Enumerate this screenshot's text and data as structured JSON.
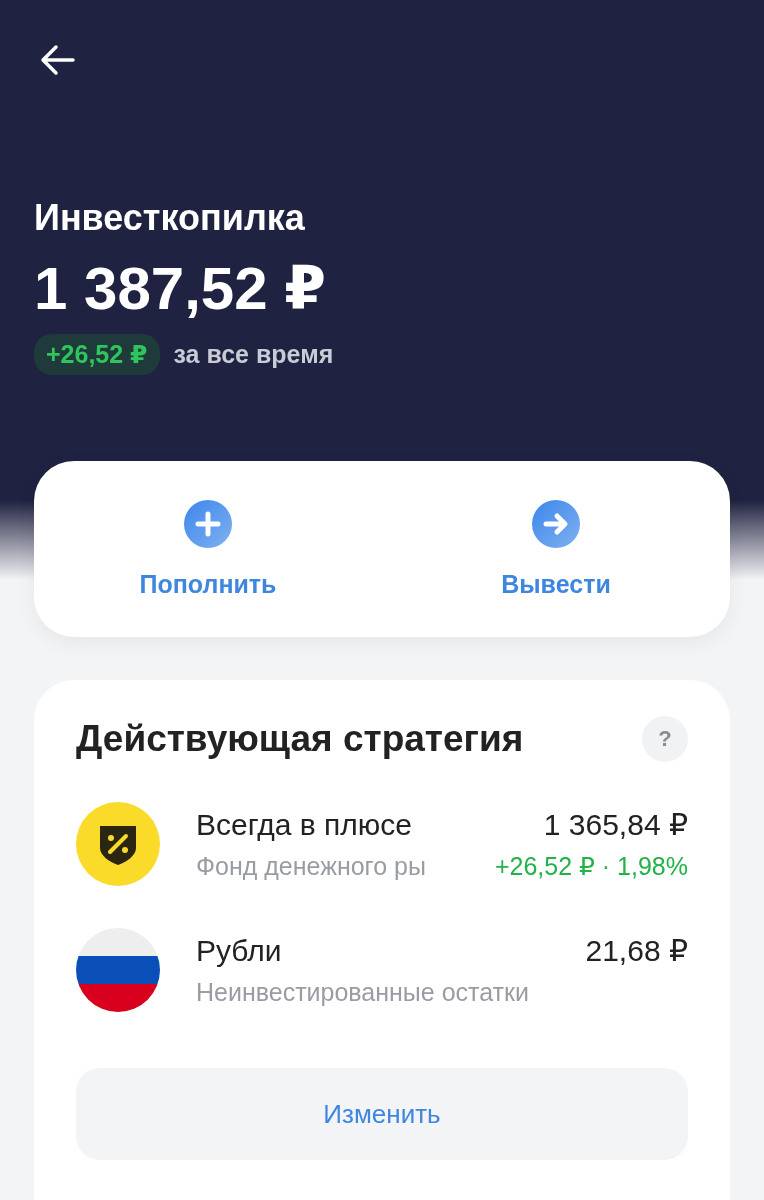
{
  "header": {
    "title": "Инвесткопилка",
    "balance": "1 387,52 ₽",
    "change": "+26,52 ₽",
    "change_period": "за все время"
  },
  "actions": [
    {
      "kind": "plus",
      "label": "Пополнить"
    },
    {
      "kind": "arrow",
      "label": "Вывести"
    }
  ],
  "strategy": {
    "title": "Действующая стратегия",
    "help": "?",
    "items": [
      {
        "kind": "fund",
        "name": "Всегда в плюсе",
        "subtitle": "Фонд денежного ры",
        "amount": "1 365,84 ₽",
        "gain": "+26,52 ₽ · 1,98%"
      },
      {
        "kind": "flag",
        "name": "Рубли",
        "subtitle": "Неинвестированные остатки",
        "amount": "21,68 ₽"
      }
    ],
    "button": "Изменить"
  }
}
